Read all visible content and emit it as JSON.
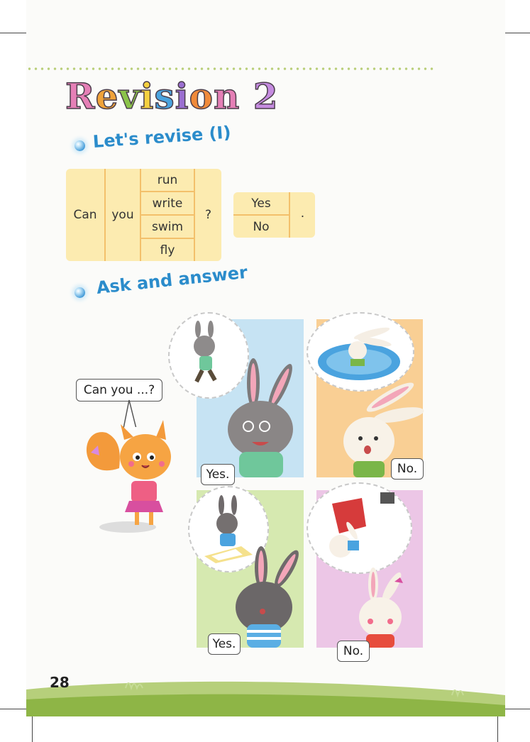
{
  "title": {
    "letters": [
      {
        "ch": "R",
        "color": "#e57fb6"
      },
      {
        "ch": "e",
        "color": "#f0a33a"
      },
      {
        "ch": "v",
        "color": "#8bc34a"
      },
      {
        "ch": "i",
        "color": "#f4d03f"
      },
      {
        "ch": "s",
        "color": "#4aa3df"
      },
      {
        "ch": "i",
        "color": "#9b6fd1"
      },
      {
        "ch": "o",
        "color": "#f08a3a"
      },
      {
        "ch": "n",
        "color": "#e57fb6"
      },
      {
        "ch": " ",
        "color": "#000000"
      },
      {
        "ch": "2",
        "color": "#c58be0"
      }
    ]
  },
  "section1": {
    "heading": "Let's revise (I)"
  },
  "section2": {
    "heading": "Ask and answer"
  },
  "revise_table": {
    "col1": "Can",
    "col2": "you",
    "verbs": [
      "run",
      "write",
      "swim",
      "fly"
    ],
    "question_mark": "?"
  },
  "answer_table": {
    "options": [
      "Yes",
      "No"
    ],
    "period": "."
  },
  "speech": {
    "squirrel": "Can you ...?",
    "panel1": "Yes.",
    "panel2": "No.",
    "panel3": "Yes.",
    "panel4": "No."
  },
  "page_number": "28",
  "colors": {
    "panel_blue": "#c6e3f3",
    "panel_orange": "#f9cf94",
    "panel_green": "#d6e9b0",
    "panel_pink": "#ecc6e6",
    "table_bg": "#fcebb0",
    "heading_blue": "#2b8ccb"
  }
}
